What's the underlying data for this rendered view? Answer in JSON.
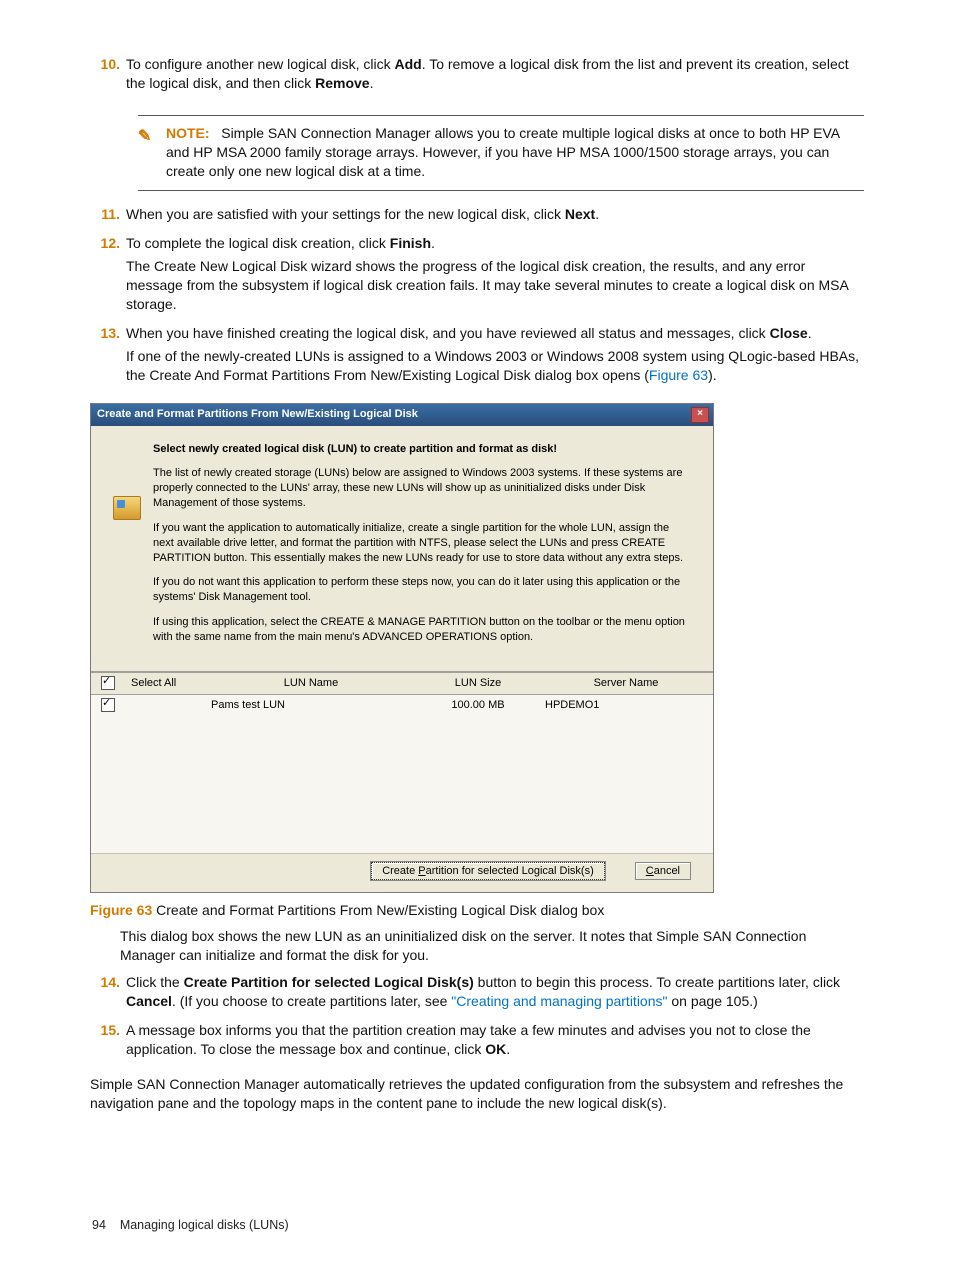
{
  "steps": {
    "s10_num": "10.",
    "s10_p1a": "To configure another new logical disk, click ",
    "s10_p1b": "Add",
    "s10_p1c": ". To remove a logical disk from the list and prevent its creation, select the logical disk, and then click ",
    "s10_p1d": "Remove",
    "s10_p1e": ".",
    "s11_num": "11.",
    "s11_p1a": "When you are satisfied with your settings for the new logical disk, click ",
    "s11_p1b": "Next",
    "s11_p1c": ".",
    "s12_num": "12.",
    "s12_p1a": "To complete the logical disk creation, click ",
    "s12_p1b": "Finish",
    "s12_p1c": ".",
    "s12_p2": "The Create New Logical Disk wizard shows the progress of the logical disk creation, the results, and any error message from the subsystem if logical disk creation fails. It may take several minutes to create a logical disk on MSA storage.",
    "s13_num": "13.",
    "s13_p1a": "When you have finished creating the logical disk, and you have reviewed all status and messages, click ",
    "s13_p1b": "Close",
    "s13_p1c": ".",
    "s13_p2a": "If one of the newly-created LUNs is assigned to a Windows 2003 or Windows 2008 system using QLogic-based HBAs, the Create And Format Partitions From New/Existing Logical Disk dialog box opens (",
    "s13_p2b": "Figure 63",
    "s13_p2c": ").",
    "s14_num": "14.",
    "s14_p1a": "Click the ",
    "s14_p1b": "Create Partition for selected Logical Disk(s)",
    "s14_p1c": " button to begin this process. To create partitions later, click ",
    "s14_p1d": "Cancel",
    "s14_p1e": ". (If you choose to create partitions later, see ",
    "s14_link": "\"Creating and managing partitions\"",
    "s14_p1f": " on page 105.)",
    "s15_num": "15.",
    "s15_p1a": "A message box informs you that the partition creation may take a few minutes and advises you not to close the application. To close the message box and continue, click ",
    "s15_p1b": "OK",
    "s15_p1c": "."
  },
  "note": {
    "label": "NOTE:",
    "body": "Simple SAN Connection Manager allows you to create multiple logical disks at once to both HP EVA and HP MSA 2000 family storage arrays. However, if you have HP MSA 1000/1500 storage arrays, you can create only one new logical disk at a time."
  },
  "dialog": {
    "title": "Create and Format Partitions From New/Existing Logical Disk",
    "heading": "Select newly created logical disk (LUN) to create partition and format as disk!",
    "p1": "The list of newly created storage (LUNs) below are assigned to Windows 2003 systems. If these systems are properly connected to the LUNs' array, these new LUNs will show up as uninitialized disks under Disk Management of those systems.",
    "p2": "If you want the application to automatically initialize, create a single partition for the whole LUN, assign the next available drive letter, and format the partition with NTFS, please select the LUNs and press CREATE PARTITION button. This essentially makes the new LUNs ready for use to store data without any extra steps.",
    "p3": "If you do not want this application to perform these steps now, you can do it later using this application or the systems' Disk Management tool.",
    "p4": "If using this application, select the CREATE & MANAGE PARTITION button on the toolbar or the menu option with the same name from the main menu's ADVANCED OPERATIONS option.",
    "th_select": "Select All",
    "th_name": "LUN Name",
    "th_size": "LUN Size",
    "th_server": "Server Name",
    "row_name": "Pams test LUN",
    "row_size": "100.00 MB",
    "row_server": "HPDEMO1",
    "btn_create_a": "Create ",
    "btn_create_u": "P",
    "btn_create_b": "artition for selected Logical Disk(s)",
    "btn_cancel_u": "C",
    "btn_cancel_b": "ancel"
  },
  "figure": {
    "label": "Figure 63",
    "caption": " Create and Format Partitions From New/Existing Logical Disk dialog box",
    "desc": "This dialog box shows the new LUN as an uninitialized disk on the server. It notes that Simple SAN Connection Manager can initialize and format the disk for you."
  },
  "closing": "Simple SAN Connection Manager automatically retrieves the updated configuration from the subsystem and refreshes the navigation pane and the topology maps in the content pane to include the new logical disk(s).",
  "footer": {
    "pagenum": "94",
    "section": "Managing logical disks (LUNs)"
  }
}
